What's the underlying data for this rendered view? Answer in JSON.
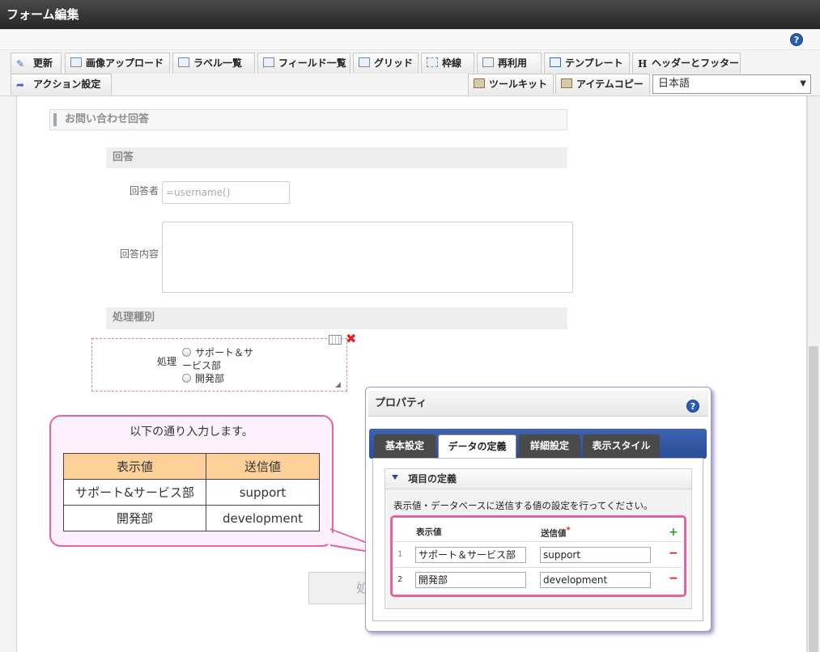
{
  "window": {
    "title": "フォーム編集"
  },
  "toolbar": {
    "row1": [
      {
        "label": "更新",
        "icon": "pen-icon"
      },
      {
        "label": "画像アップロード",
        "icon": "image-upload-icon"
      },
      {
        "label": "ラベル一覧",
        "icon": "label-list-icon"
      },
      {
        "label": "フィールド一覧",
        "icon": "field-list-icon"
      },
      {
        "label": "グリッド",
        "icon": "grid-icon"
      },
      {
        "label": "枠線",
        "icon": "border-icon"
      },
      {
        "label": "再利用",
        "icon": "reuse-icon"
      },
      {
        "label": "テンプレート",
        "icon": "template-icon"
      },
      {
        "label": "ヘッダーとフッター",
        "icon": "header-footer-icon"
      }
    ],
    "row2": [
      {
        "label": "アクション設定",
        "icon": "action-icon"
      },
      {
        "label": "ツールキット",
        "icon": "toolkit-icon"
      },
      {
        "label": "アイテムコピー",
        "icon": "item-copy-icon"
      }
    ],
    "language": "日本語"
  },
  "form": {
    "section_title": "お問い合わせ回答",
    "answer_heading": "回答",
    "respondent_label": "回答者",
    "respondent_value": "=username()",
    "content_label": "回答内容",
    "process_heading": "処理種別",
    "process_label": "処理",
    "radio_options": [
      "サポート＆サ",
      "ービス部",
      "開発部"
    ],
    "bottom_button_partial": "処"
  },
  "callout": {
    "title": "以下の通り入力します。",
    "headers": [
      "表示値",
      "送信値"
    ],
    "rows": [
      [
        "サポート&サービス部",
        "support"
      ],
      [
        "開発部",
        "development"
      ]
    ]
  },
  "dialog": {
    "title": "プロパティ",
    "tabs": [
      "基本設定",
      "データの定義",
      "詳細設定",
      "表示スタイル"
    ],
    "active_tab": "データの定義",
    "section_title": "項目の定義",
    "description": "表示値・データベースに送信する値の設定を行ってください。",
    "col_display": "表示値",
    "col_send": "送信値",
    "required_mark": "*",
    "add_symbol": "+",
    "remove_symbol": "−",
    "rows": [
      {
        "num": "1",
        "display": "サポート＆サービス部",
        "send": "support"
      },
      {
        "num": "2",
        "display": "開発部",
        "send": "development"
      }
    ]
  }
}
